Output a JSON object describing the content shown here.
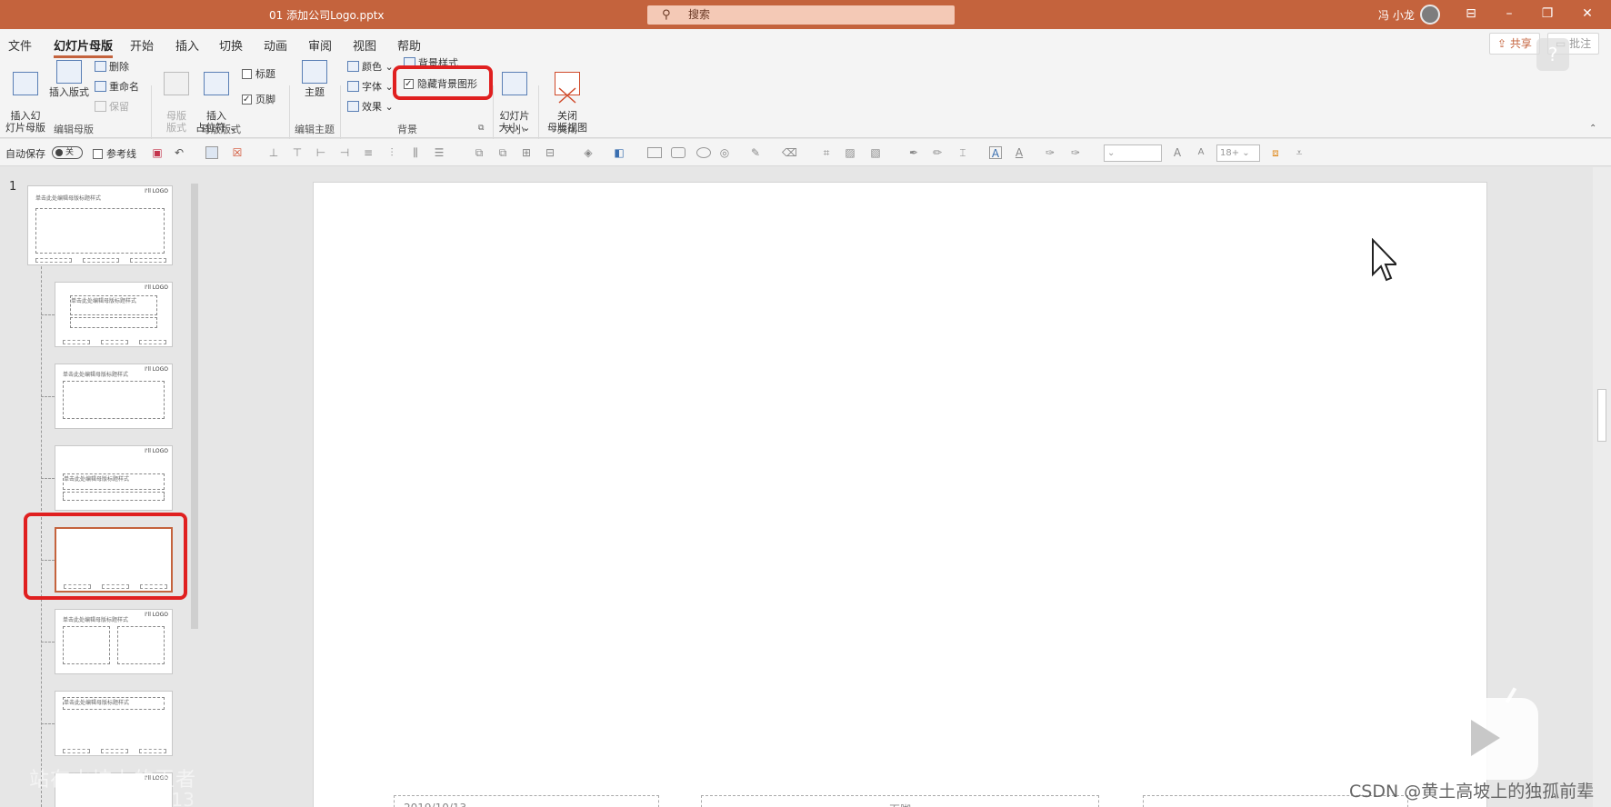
{
  "titlebar": {
    "doc_title": "01 添加公司Logo.pptx",
    "search_placeholder": "搜索",
    "user": "冯 小龙"
  },
  "ribbon": {
    "tabs": [
      "文件",
      "幻灯片母版",
      "开始",
      "插入",
      "切换",
      "动画",
      "审阅",
      "视图",
      "帮助"
    ],
    "active_tab": "幻灯片母版",
    "share_label": "共享",
    "comment_label": "批注",
    "groups": {
      "edit_master": {
        "label": "编辑母版",
        "insert_slide_master": "插入幻\n灯片母版",
        "insert_layout": "插入版式",
        "delete": "删除",
        "rename": "重命名",
        "preserve": "保留"
      },
      "master_layout": {
        "label": "母版版式",
        "master_layout_btn": "母版\n版式",
        "insert_placeholder": "插入\n占位符 ⌄",
        "title_check": "标题",
        "footer_check": "页脚"
      },
      "edit_theme": {
        "label": "编辑主题",
        "theme": "主题"
      },
      "background": {
        "label": "背景",
        "colors": "颜色 ⌄",
        "fonts": "字体 ⌄",
        "effects": "效果 ⌄",
        "background_styles": "背景样式",
        "hide_background_graphics": "隐藏背景图形"
      },
      "size": {
        "label": "大小",
        "slide_size": "幻灯片\n大小 ⌄"
      },
      "close": {
        "label": "关闭",
        "close_master_view": "关闭\n母版视图"
      }
    }
  },
  "quickbar": {
    "autosave_label": "自动保存",
    "autosave_state": "关",
    "guides_label": "参考线",
    "font_size": "18+"
  },
  "slides": {
    "number": "1",
    "master_title_text": "单击此处编辑母版标题样式",
    "logo_text": "I'll LOGO"
  },
  "canvas": {
    "footer_left": "2019/10/13",
    "footer_center": "页脚"
  },
  "watermarks": {
    "left_line1": "站在山坡上的王者",
    "left_line2": "39125713",
    "right": "CSDN @黄土高坡上的独孤前辈"
  },
  "colors": {
    "accent": "#c4633d",
    "highlight": "#e02020"
  }
}
